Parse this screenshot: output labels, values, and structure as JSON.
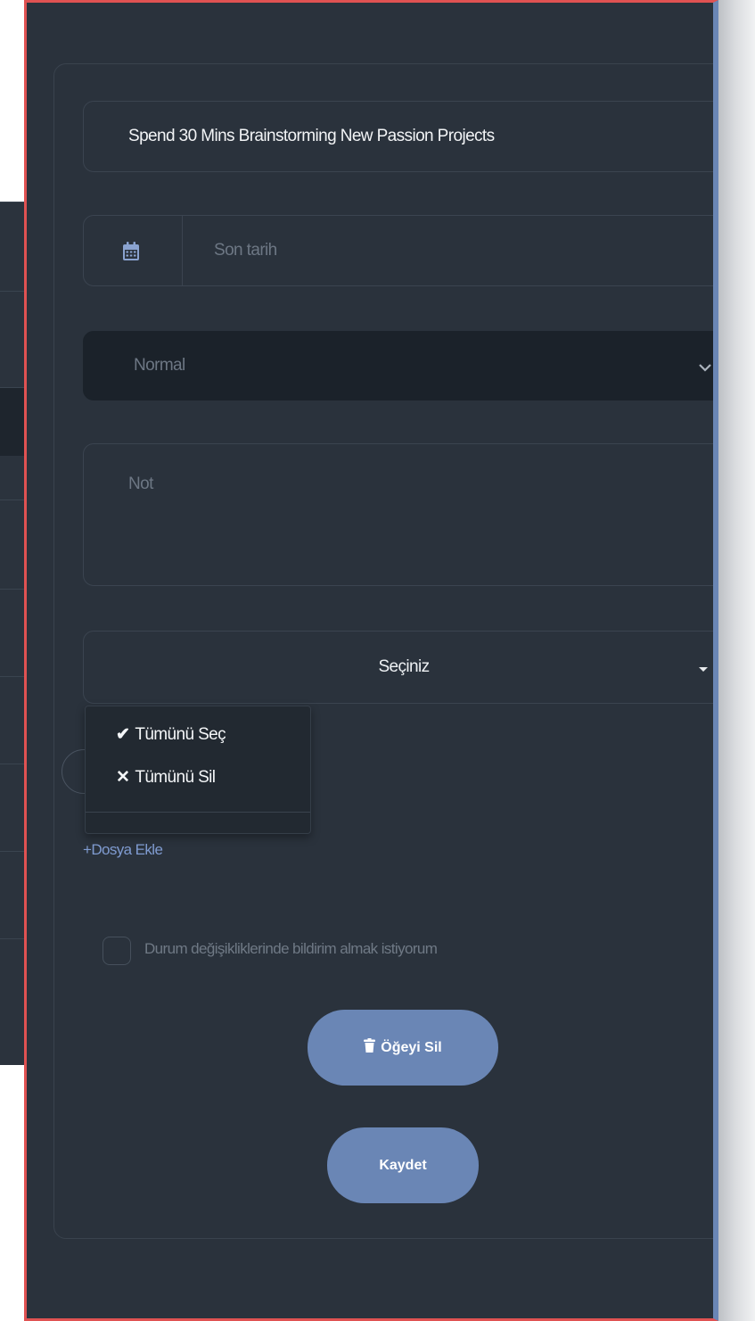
{
  "task": {
    "title_value": "Spend 30 Mins Brainstorming New Passion Projects",
    "due_date_placeholder": "Son tarih",
    "priority_selected": "Normal",
    "note_placeholder": "Not",
    "assignee_select_label": "Seçiniz"
  },
  "dropdown": {
    "select_all": "Tümünü Seç",
    "clear_all": "Tümünü Sil"
  },
  "icons": {
    "calendar": "calendar-icon",
    "chevron": "chevron-down-icon",
    "caret": "caret-down-icon",
    "check": "checkmark-icon",
    "cross": "cross-icon",
    "trash": "trash-icon"
  },
  "attachments": {
    "add_label": "+Dosya Ekle"
  },
  "notify": {
    "label": "Durum değişikliklerinde bildirim almak istiyorum",
    "checked": false
  },
  "actions": {
    "delete_label": "Öğeyi Sil",
    "save_label": "Kaydet"
  },
  "colors": {
    "panel_bg": "#2a323c",
    "accent": "#6a86b5",
    "link": "#7f9bd0",
    "highlight_border": "#e05252"
  }
}
